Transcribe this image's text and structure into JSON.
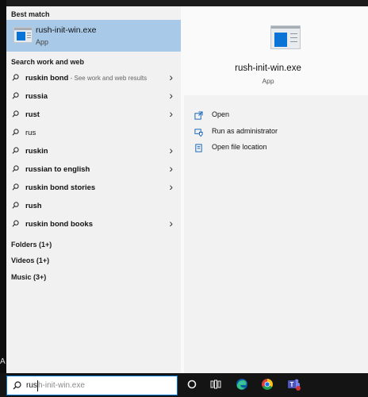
{
  "desktop": {
    "edge_label": "A"
  },
  "best_match": {
    "section_title": "Best match",
    "name": "rush-init-win.exe",
    "type": "App",
    "icon": "application-window-icon"
  },
  "search_work_web": {
    "section_title": "Search work and web",
    "items": [
      {
        "text": "ruskin bond",
        "subtext": " - See work and web results",
        "bold": true,
        "chevron": true
      },
      {
        "text": "russia",
        "subtext": "",
        "bold": true,
        "chevron": true
      },
      {
        "text": "rust",
        "subtext": "",
        "bold": true,
        "chevron": true
      },
      {
        "text": "rus",
        "subtext": "",
        "bold": false,
        "chevron": false
      },
      {
        "text": "ruskin",
        "subtext": "",
        "bold": true,
        "chevron": true
      },
      {
        "text": "russian to english",
        "subtext": "",
        "bold": true,
        "chevron": true
      },
      {
        "text": "ruskin bond stories",
        "subtext": "",
        "bold": true,
        "chevron": true
      },
      {
        "text": "rush",
        "subtext": "",
        "bold": true,
        "chevron": false
      },
      {
        "text": "ruskin bond books",
        "subtext": "",
        "bold": true,
        "chevron": true
      }
    ]
  },
  "categories": {
    "folders": "Folders (1+)",
    "videos": "Videos (1+)",
    "music": "Music (3+)"
  },
  "detail": {
    "name": "rush-init-win.exe",
    "type": "App",
    "actions": {
      "open": "Open",
      "run_as_admin": "Run as administrator",
      "open_file_location": "Open file location"
    }
  },
  "taskbar": {
    "search": {
      "typed": "rus",
      "autocomplete": "h-init-win.exe"
    },
    "icons": [
      "cortana-circle-icon",
      "task-view-icon",
      "edge-icon",
      "chrome-icon",
      "teams-icon"
    ]
  },
  "colors": {
    "selection": "#a8cae8",
    "accent": "#0078d7",
    "left_pane": "#f1f1f1",
    "taskbar": "#141414"
  }
}
